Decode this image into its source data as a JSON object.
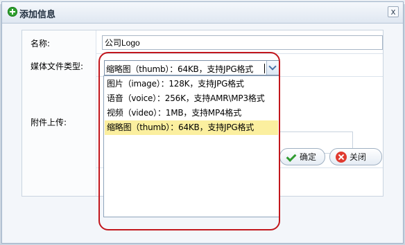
{
  "dialog": {
    "title": "添加信息",
    "close_label": "x"
  },
  "form": {
    "name_label": "名称:",
    "name_value": "公司Logo",
    "media_type_label": "媒体文件类型:",
    "media_type_value": "缩略图（thumb）：64KB，支持JPG格式",
    "upload_label": "附件上传:"
  },
  "dropdown": {
    "options": [
      "图片（image）：128K，支持JPG格式",
      "语音（voice）：256K，支持AMR\\MP3格式",
      "视频（video）：1MB，支持MP4格式",
      "缩略图（thumb）：64KB，支持JPG格式"
    ],
    "selected_index": 3
  },
  "buttons": {
    "ok_label": "确定",
    "close_label": "关闭"
  },
  "colors": {
    "highlight_option": "#fbef9f",
    "callout_border": "#c2161c"
  }
}
